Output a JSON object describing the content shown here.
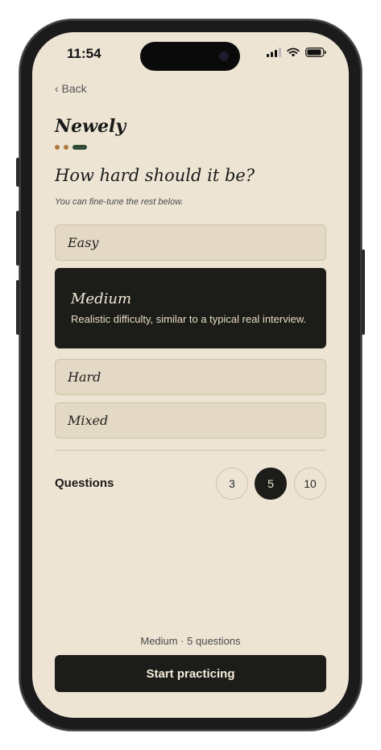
{
  "status_bar": {
    "time": "11:54"
  },
  "nav": {
    "back_label": "‹ Back"
  },
  "app": {
    "brand": "Newely"
  },
  "step": {
    "current": 3,
    "total": 3
  },
  "difficulty": {
    "question": "How hard should it be?",
    "hint": "You can fine-tune the rest below.",
    "options": [
      {
        "label": "Easy",
        "selected": false
      },
      {
        "label": "Medium",
        "selected": true,
        "description": "Realistic difficulty, similar to a typical real interview."
      },
      {
        "label": "Hard",
        "selected": false
      },
      {
        "label": "Mixed",
        "selected": false
      }
    ]
  },
  "questions": {
    "label": "Questions",
    "options": [
      "3",
      "5",
      "10"
    ],
    "selected": "5"
  },
  "summary": "Medium · 5 questions",
  "start_button": {
    "label": "Start practicing"
  },
  "colors": {
    "background": "#ede4d4",
    "option_bg": "#e4d9c4",
    "selected_bg": "#1c1c18",
    "dot_inactive": "#b0793f",
    "dot_active": "#2f4a36"
  }
}
